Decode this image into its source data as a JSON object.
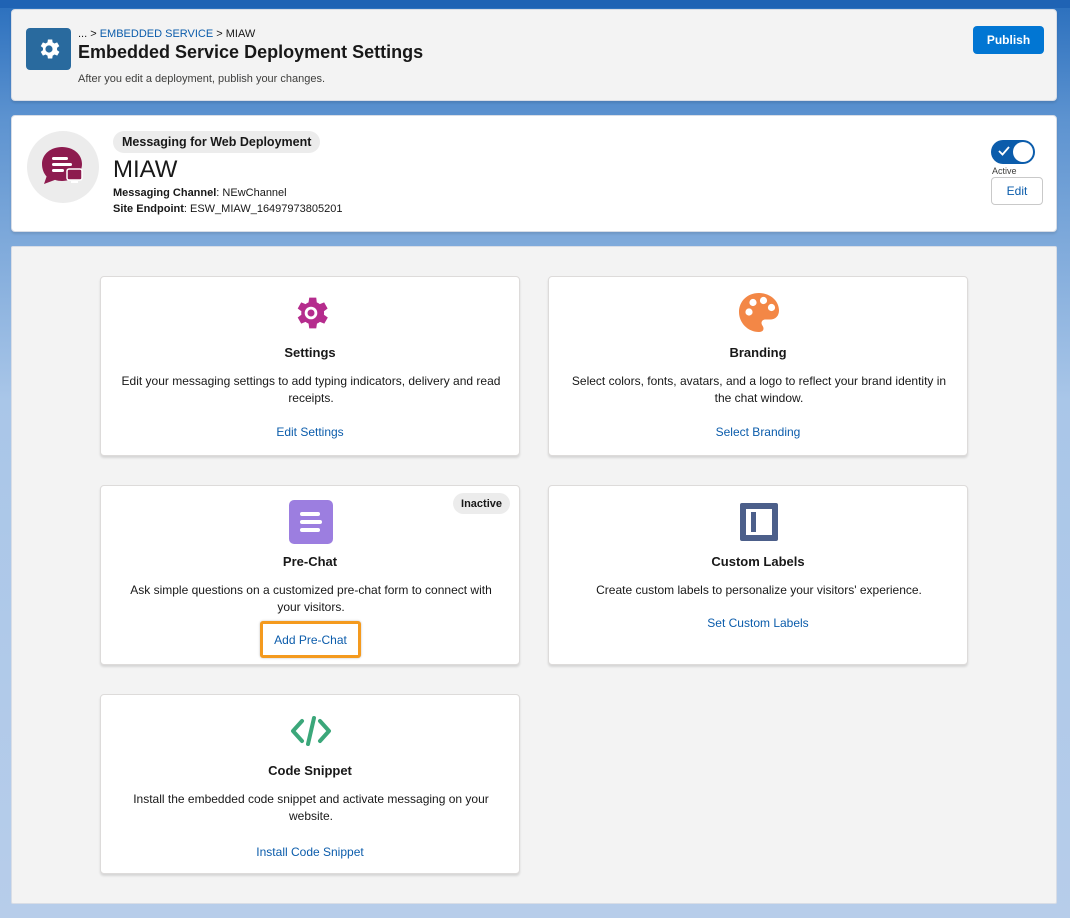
{
  "header": {
    "breadcrumb_prefix": "... > ",
    "breadcrumb_link": "EMBEDDED SERVICE",
    "breadcrumb_suffix": " > MIAW",
    "title": "Embedded Service Deployment Settings",
    "subtitle": "After you edit a deployment, publish your changes.",
    "publish_label": "Publish",
    "icon": "gear-icon"
  },
  "deployment": {
    "type_badge": "Messaging for Web Deployment",
    "name": "MIAW",
    "channel_label": "Messaging Channel",
    "channel_value": ": NEwChannel",
    "endpoint_label": "Site Endpoint",
    "endpoint_value": ": ESW_MIAW_16497973805201",
    "active_label": "Active",
    "active": true,
    "edit_label": "Edit",
    "avatar_icon": "messaging-chat-icon"
  },
  "tiles": [
    {
      "title": "Settings",
      "description": "Edit your messaging settings to add typing indicators, delivery and read receipts.",
      "link": "Edit Settings",
      "icon": "gear-icon",
      "color": "#b52c8d"
    },
    {
      "title": "Branding",
      "description": "Select colors, fonts, avatars, and a logo to reflect your brand identity in the chat window.",
      "link": "Select Branding",
      "icon": "palette-icon",
      "color": "#f38746"
    },
    {
      "title": "Pre-Chat",
      "description": "Ask simple questions on a customized pre-chat form to connect with your visitors.",
      "link": "Add Pre-Chat",
      "badge": "Inactive",
      "icon": "form-icon",
      "color": "#9c7ee0"
    },
    {
      "title": "Custom Labels",
      "description": "Create custom labels to personalize your visitors' experience.",
      "link": "Set Custom Labels",
      "icon": "custom-labels-icon",
      "color": "#4c5f8a"
    },
    {
      "title": "Code Snippet",
      "description": "Install the embedded code snippet and activate messaging on your website.",
      "link": "Install Code Snippet",
      "icon": "code-icon",
      "color": "#3ba77a"
    }
  ]
}
